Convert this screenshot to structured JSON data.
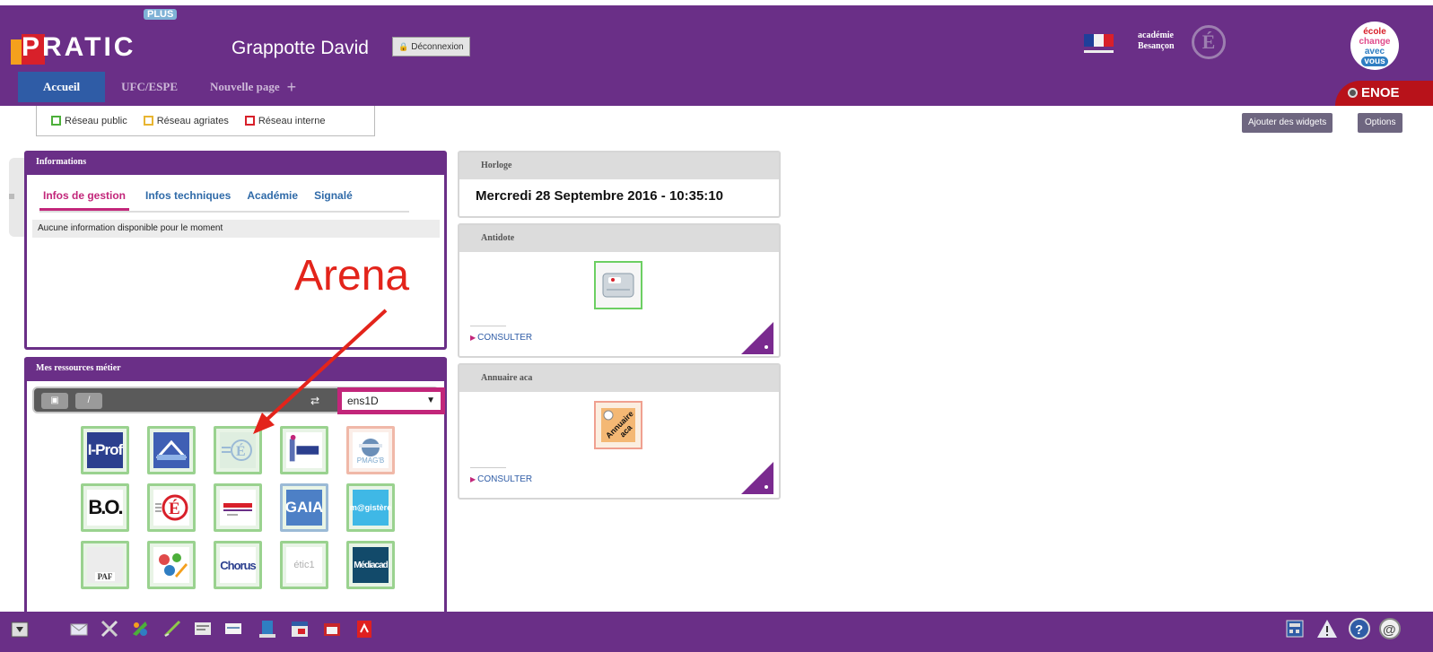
{
  "header": {
    "logo_text": "PRATIC",
    "logo_badge": "PLUS",
    "user_name": "Grappotte David",
    "logout_label": "Déconnexion",
    "nav_tabs": [
      "Accueil",
      "UFC/ESPE",
      "Nouvelle page"
    ],
    "nav_add": "+",
    "academie_text": "académie Besançon",
    "ecole_badge": [
      "école",
      "change",
      "avec",
      "vous"
    ],
    "enoe_label": "ENOE"
  },
  "legend": {
    "items": [
      {
        "label": "Réseau public",
        "color": "#4caf3a"
      },
      {
        "label": "Réseau agriates",
        "color": "#e8b531"
      },
      {
        "label": "Réseau interne",
        "color": "#d8202a"
      }
    ]
  },
  "toolbar": {
    "add_widgets_label": "Ajouter des widgets",
    "options_label": "Options"
  },
  "info_widget": {
    "title": "Informations",
    "tabs": [
      "Infos de gestion",
      "Infos techniques",
      "Académie",
      "Signalé"
    ],
    "message": "Aucune information disponible pour le moment"
  },
  "resources_widget": {
    "title": "Mes ressources métier",
    "profile_select": "ens1D",
    "tiles": [
      {
        "name": "iprof",
        "text": "I-Prof"
      },
      {
        "name": "webmail",
        "text": ""
      },
      {
        "name": "arena",
        "text": ""
      },
      {
        "name": "eduscol",
        "text": ""
      },
      {
        "name": "esidmag",
        "text": "PMAG'B"
      },
      {
        "name": "bo",
        "text": "B.O."
      },
      {
        "name": "education-nationale",
        "text": ""
      },
      {
        "name": "canope",
        "text": ""
      },
      {
        "name": "gaia",
        "text": "GAIA"
      },
      {
        "name": "magistere",
        "text": "m@gistère"
      },
      {
        "name": "paf",
        "text": "PAF"
      },
      {
        "name": "pedagogie",
        "text": ""
      },
      {
        "name": "chorus",
        "text": "Chorus"
      },
      {
        "name": "etic1",
        "text": "étic1"
      },
      {
        "name": "mediacad",
        "text": "Médiacad"
      }
    ]
  },
  "clock_widget": {
    "title": "Horloge",
    "datetime": "Mercredi 28 Septembre 2016 - 10:35:10"
  },
  "antidote_widget": {
    "title": "Antidote",
    "link": "CONSULTER"
  },
  "annuaire_widget": {
    "title": "Annuaire aca",
    "icon_text": "Annuaire aca",
    "link": "CONSULTER"
  },
  "annotation": {
    "label": "Arena",
    "color": "#e3241b"
  },
  "taskbar": {
    "icons": [
      "menu-icon",
      "mail-icon",
      "tools-icon",
      "palette-icon",
      "pen-icon",
      "document-icon",
      "notes-icon",
      "archive-icon",
      "calendar-icon",
      "folder-icon",
      "pdf-icon"
    ],
    "right_icons": [
      "calculator-icon",
      "warning-icon",
      "help-icon",
      "at-icon"
    ]
  },
  "colors": {
    "brand_purple": "#6a2f87",
    "accent_pink": "#c2267a",
    "nav_blue": "#2f5ca6",
    "enoe_red": "#b8121a"
  }
}
